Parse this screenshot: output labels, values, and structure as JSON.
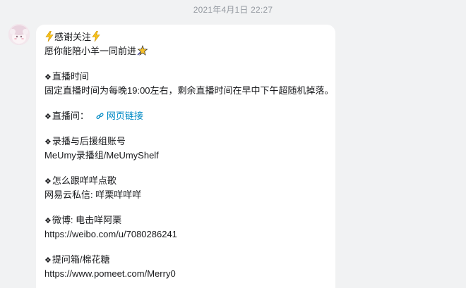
{
  "timestamp": "2021年4月1日 22:27",
  "message": {
    "title": "感谢关注",
    "subtitle": "愿你能陪小羊一同前进",
    "live_time_heading": "直播时间",
    "live_time_text": "固定直播时间为每晚19:00左右，剩余直播时间在早中下午超随机掉落。",
    "live_room_heading": "直播间：",
    "live_room_link": "网页链接",
    "record_heading": "录播与后援组账号",
    "record_text": "MeUmy录播组/MeUmyShelf",
    "song_heading": "怎么跟咩咩点歌",
    "song_text": "网易云私信: 咩栗咩咩咩",
    "weibo_heading": "微博: 电击咩阿栗",
    "weibo_url": "https://weibo.com/u/7080286241",
    "qbox_heading": "提问箱/棉花糖",
    "qbox_url": "https://www.pomeet.com/Merry0"
  },
  "colors": {
    "background": "#f1f2f3",
    "bubble": "#ffffff",
    "link": "#008ac5",
    "bolt": "#f7c21a"
  }
}
